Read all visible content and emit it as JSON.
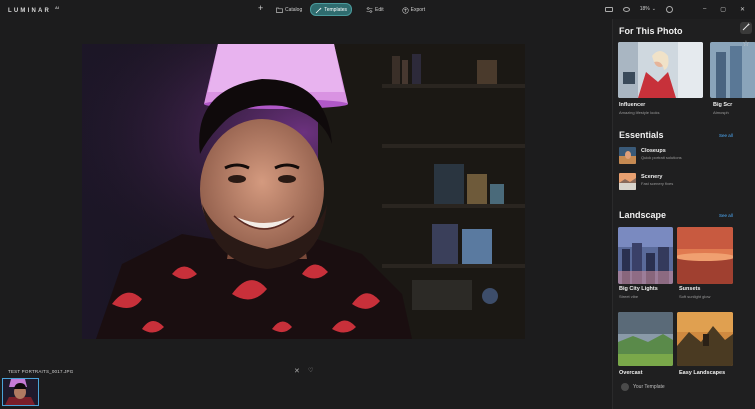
{
  "app": {
    "logo": "LUMINAR",
    "logo_sup": "AI"
  },
  "nav": {
    "add_label": "+",
    "catalog": "Catalog",
    "templates": "Templates",
    "edit": "Edit",
    "export": "Export"
  },
  "toolbar": {
    "zoom": "18%",
    "zoom_caret": "⌄"
  },
  "window": {
    "minimize": "–",
    "maximize": "▢",
    "close": "✕"
  },
  "filmstrip": {
    "filename": "TEST PORTRAITS_0017.JPG"
  },
  "panel": {
    "for_this_photo": {
      "title": "For This Photo",
      "cards": [
        {
          "title": "Influencer",
          "subtitle": "Amazing lifestyle looks"
        },
        {
          "title": "Big Scr",
          "subtitle": "Atmosph"
        }
      ]
    },
    "essentials": {
      "title": "Essentials",
      "see_all": "See all",
      "items": [
        {
          "title": "Closeups",
          "subtitle": "Quick portrait solutions"
        },
        {
          "title": "Scenery",
          "subtitle": "Fast scenery fixes"
        }
      ]
    },
    "landscape": {
      "title": "Landscape",
      "see_all": "See all",
      "cards": [
        {
          "title": "Big City Lights",
          "subtitle": "Street vibe"
        },
        {
          "title": "Sunsets",
          "subtitle": "Soft sunlight glow"
        },
        {
          "title": "Overcast",
          "subtitle": ""
        },
        {
          "title": "Easy Landscapes",
          "subtitle": ""
        }
      ]
    },
    "your_template": "Your Template"
  }
}
